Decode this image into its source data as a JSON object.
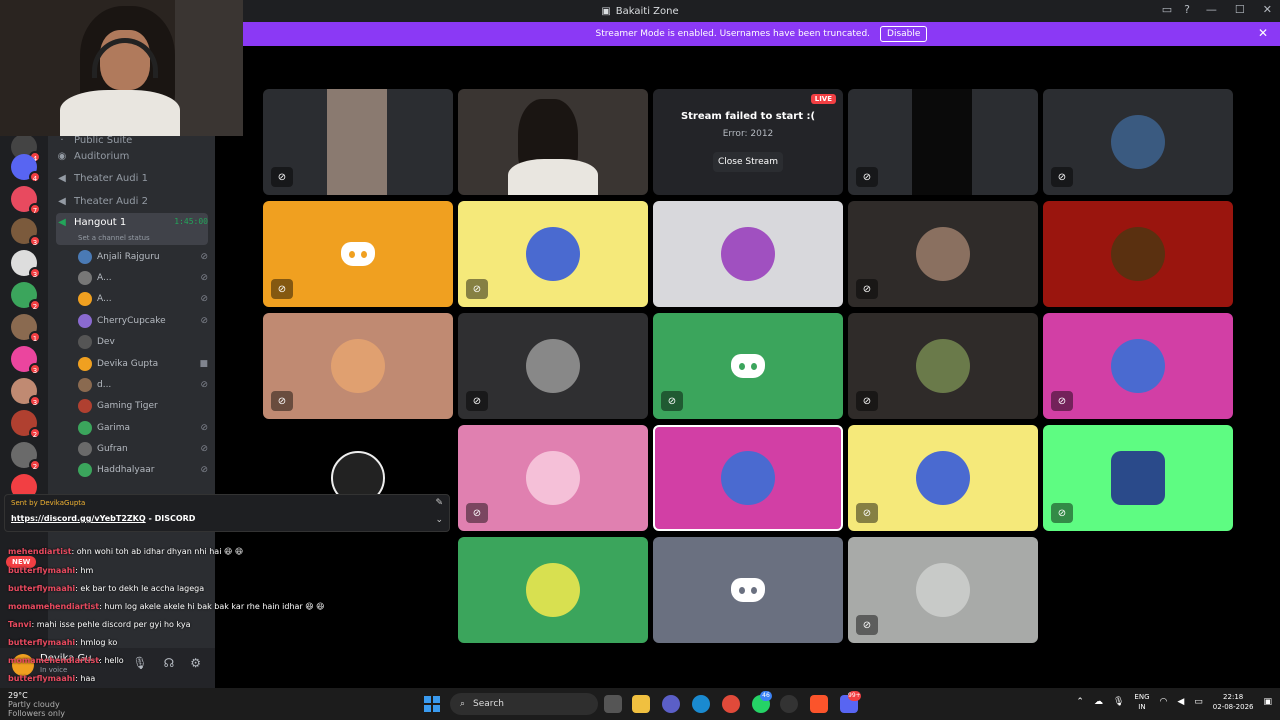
{
  "window": {
    "title": "Bakaiti Zone"
  },
  "banner": {
    "text": "Streamer Mode is enabled. Usernames have been truncated.",
    "button": "Disable"
  },
  "server_badges": [
    "4",
    "4",
    "7",
    "3",
    "3",
    "2",
    "1",
    "3",
    "3",
    "2",
    "2"
  ],
  "channels": {
    "category_label": "Public Suite",
    "items": [
      {
        "name": "Auditorium"
      },
      {
        "name": "Theater Audi 1"
      },
      {
        "name": "Theater Audi 2"
      },
      {
        "name": "Hangout 1",
        "timer": "1:45:00",
        "status": "Set a channel status"
      }
    ],
    "members": [
      {
        "name": "Anjali Rajguru"
      },
      {
        "name": "A..."
      },
      {
        "name": "A..."
      },
      {
        "name": "CherryCupcake"
      },
      {
        "name": "Dev"
      },
      {
        "name": "Devika Gupta"
      },
      {
        "name": "d..."
      },
      {
        "name": "Gaming Tiger"
      },
      {
        "name": "Garima"
      },
      {
        "name": "Gufran"
      },
      {
        "name": "Haddhalyaar"
      }
    ]
  },
  "stream_error": {
    "title": "Stream failed to start :(",
    "detail": "Error: 2012",
    "button": "Close Stream",
    "live": "LIVE"
  },
  "link_message": {
    "sent_by": "Sent by",
    "sender": "DevikaGupta",
    "url": "https://discord.gg/vYebT2ZKQ",
    "suffix": " - DISCORD"
  },
  "chat": [
    {
      "name": "mehendiartist",
      "text": ": ohn wohi toh ab idhar dhyan nhi hai 😆 😆"
    },
    {
      "name": "butterflymaahi",
      "text": ": hm"
    },
    {
      "name": "butterflymaahi",
      "text": ": ek bar to dekh le accha lagega"
    },
    {
      "name": "momamehendiartist",
      "text": ": hum log akele akele hi bak bak kar rhe hain idhar 😆 😆"
    },
    {
      "name": "Tanvi",
      "text": ": mahi isse pehle discord per gyi ho kya"
    },
    {
      "name": "butterflymaahi",
      "text": ": hmlog ko"
    },
    {
      "name": "momamehendiartist",
      "text": ": hello"
    },
    {
      "name": "butterflymaahi",
      "text": ": haa"
    }
  ],
  "new_tag": "NEW",
  "user_panel": {
    "name": "Devika Gu...",
    "status": "In voice"
  },
  "taskbar": {
    "weather_temp": "29°C",
    "weather_desc": "Partly cloudy",
    "followers": "Followers only",
    "search": "Search",
    "badges": [
      "46",
      "99+"
    ],
    "lang": "ENG",
    "region": "IN",
    "time": "22:18",
    "date": "02-08-2026"
  },
  "colors": {
    "accent": "#8b39f5",
    "green": "#23a55a",
    "red": "#f23f43",
    "orange": "#f0a020",
    "yellow": "#f5e97a",
    "magenta": "#d23fa5",
    "tan": "#c08a72",
    "mint": "#5efc82"
  }
}
